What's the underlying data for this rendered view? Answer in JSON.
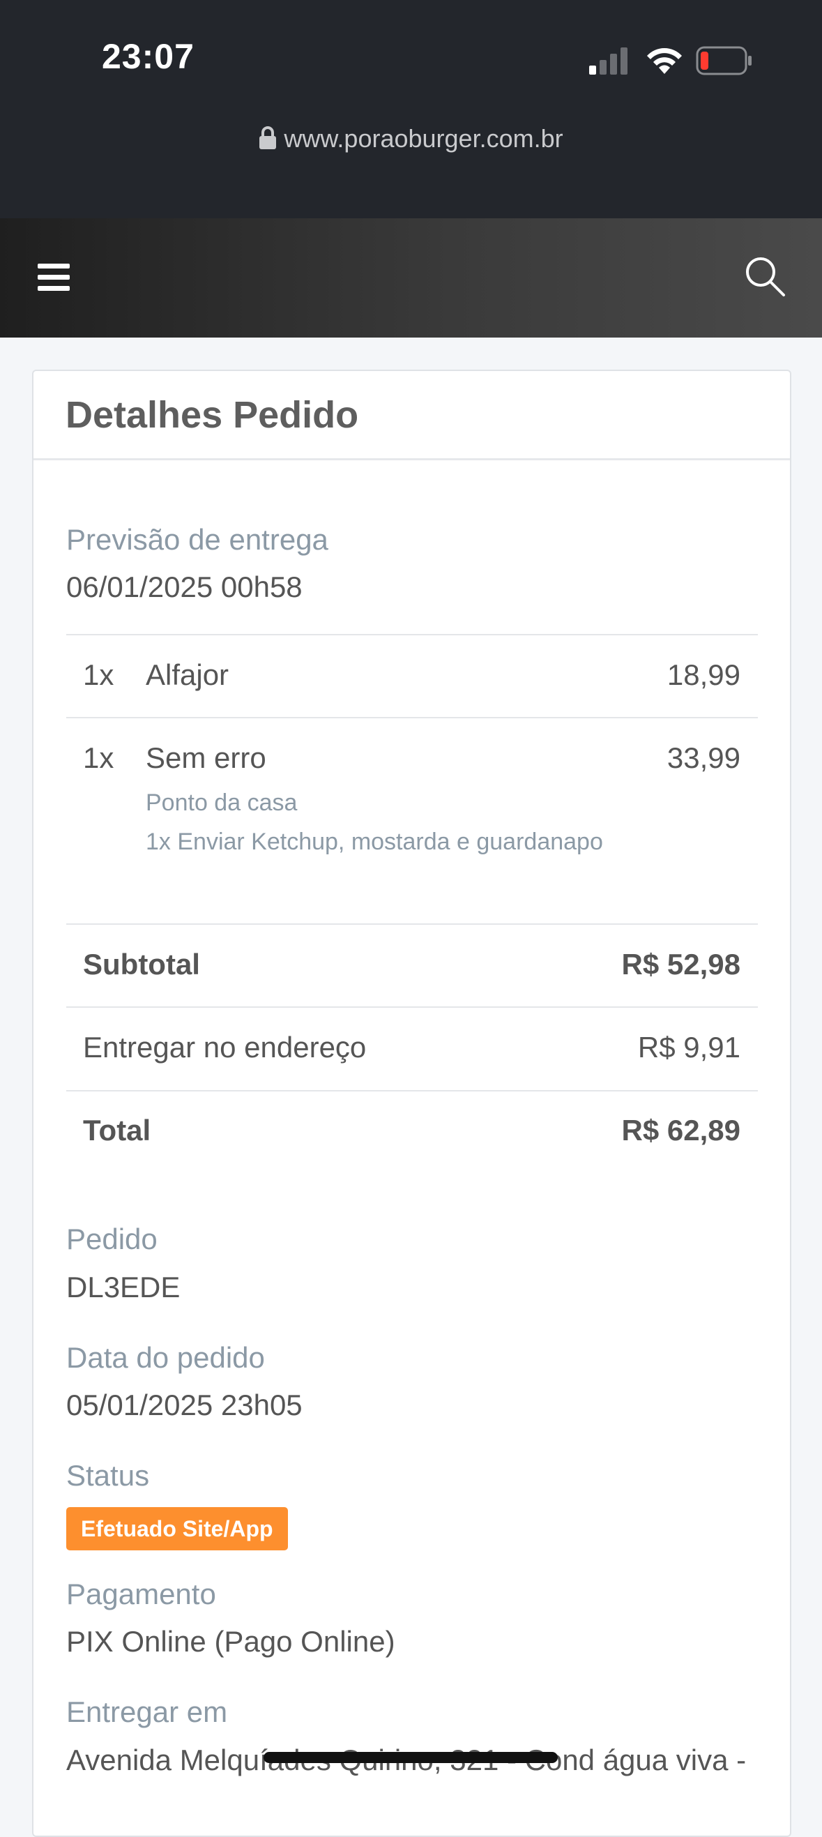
{
  "status_bar": {
    "time": "23:07",
    "signal_icon": "cellular-signal-icon",
    "wifi_icon": "wifi-icon",
    "battery_icon": "battery-low-icon",
    "battery_color": "#ff3b30"
  },
  "browser": {
    "url": "www.poraoburger.com.br",
    "lock_icon": "lock-icon"
  },
  "site_header": {
    "menu_icon": "hamburger-menu-icon",
    "search_icon": "search-icon"
  },
  "order": {
    "title": "Detalhes Pedido",
    "delivery_forecast": {
      "label": "Previsão de entrega",
      "value": "06/01/2025 00h58"
    },
    "items": [
      {
        "qty": "1x",
        "name": "Alfajor",
        "price": "18,99",
        "details": []
      },
      {
        "qty": "1x",
        "name": "Sem erro",
        "price": "33,99",
        "details": [
          "Ponto da casa",
          "1x Enviar Ketchup, mostarda e guardanapo"
        ]
      }
    ],
    "summary": {
      "subtotal_label": "Subtotal",
      "subtotal_value": "R$ 52,98",
      "delivery_label": "Entregar no endereço",
      "delivery_value": "R$ 9,91",
      "total_label": "Total",
      "total_value": "R$ 62,89"
    },
    "order_id": {
      "label": "Pedido",
      "value": "DL3EDE"
    },
    "order_date": {
      "label": "Data do pedido",
      "value": "05/01/2025 23h05"
    },
    "status": {
      "label": "Status",
      "badge": "Efetuado Site/App",
      "badge_color": "#fd8f2e"
    },
    "payment": {
      "label": "Pagamento",
      "value": "PIX Online (Pago Online)"
    },
    "deliver_at": {
      "label": "Entregar em",
      "value": "Avenida Melquíades Quirino, 321 - Cond água viva -"
    }
  }
}
